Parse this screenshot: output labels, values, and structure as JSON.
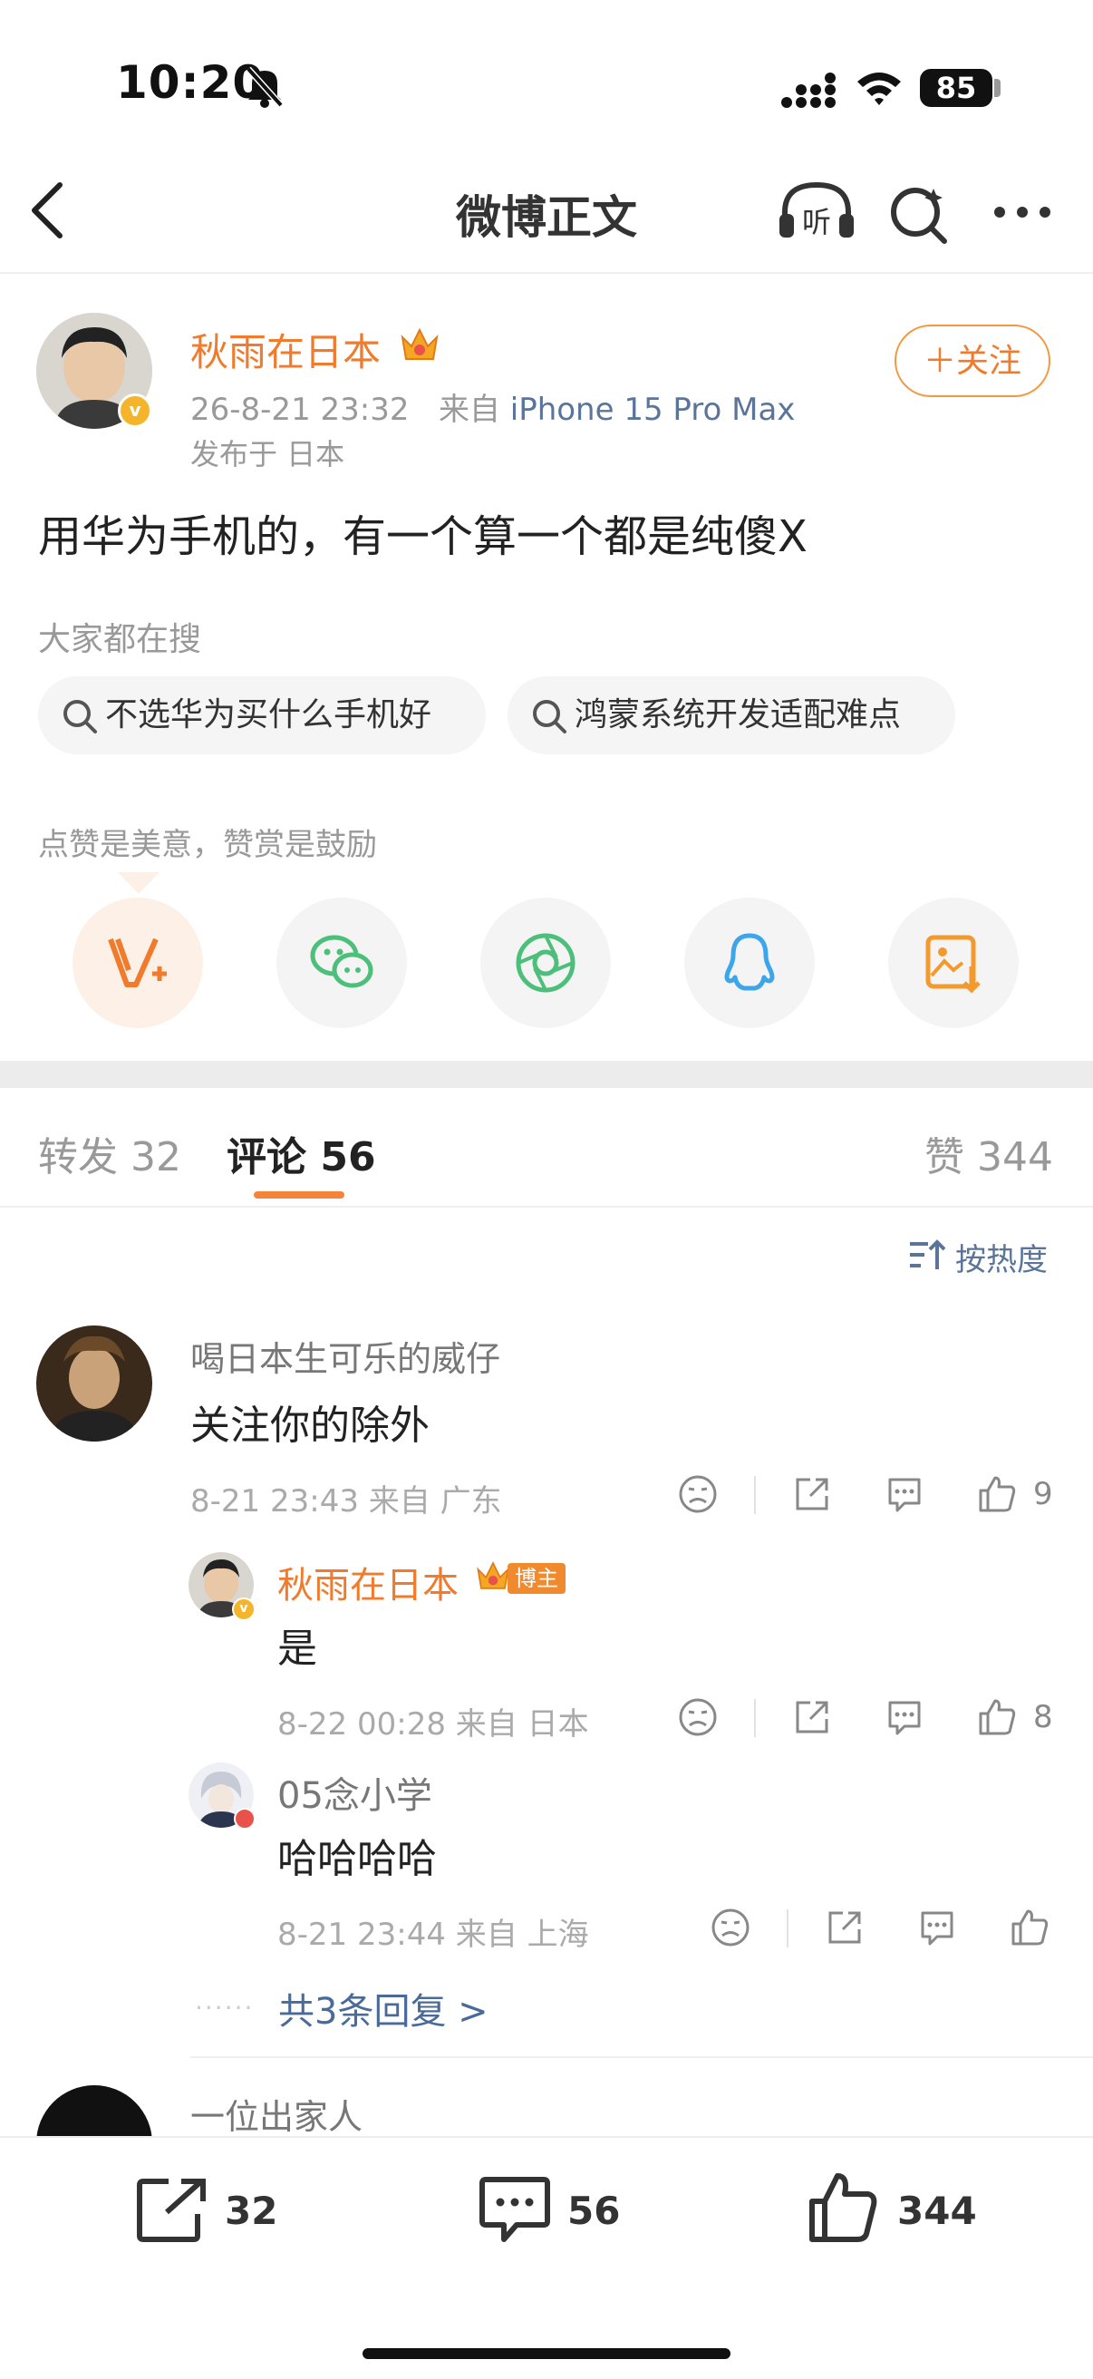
{
  "status_bar": {
    "time": "10:20",
    "battery": "85"
  },
  "nav": {
    "title": "微博正文"
  },
  "post": {
    "author": "秋雨在日本",
    "date": "26-8-21 23:32",
    "source_prefix": "来自",
    "device": "iPhone 15 Pro Max",
    "location": "发布于 日本",
    "follow_label": "＋关注",
    "text": "用华为手机的，有一个算一个都是纯傻X"
  },
  "search": {
    "label": "大家都在搜",
    "chips": [
      "不选华为买什么手机好",
      "鸿蒙系统开发适配难点"
    ]
  },
  "reward": {
    "label": "点赞是美意，赞赏是鼓励"
  },
  "tabs": {
    "repost": "转发 32",
    "comment_label": "评论",
    "comment_count": "56",
    "like": "赞 344"
  },
  "sort_label": "按热度",
  "comments": [
    {
      "user": "喝日本生可乐的威仔",
      "text": "关注你的除外",
      "meta": "8-21 23:43  来自 广东",
      "likes": "9",
      "replies": [
        {
          "user": "秋雨在日本",
          "badge": "博主",
          "text": "是",
          "meta": "8-22 00:28  来自 日本",
          "likes": "8"
        },
        {
          "user": "05念小学",
          "text": "哈哈哈哈",
          "meta": "8-21 23:44  来自 上海",
          "likes": ""
        }
      ],
      "more_replies": "共3条回复 >"
    },
    {
      "user": "一位出家人"
    }
  ],
  "bottom_bar": {
    "repost": "32",
    "comment": "56",
    "like": "344"
  },
  "colors": {
    "accent": "#f07b2c",
    "link": "#5a7599",
    "badge": "#f5b52a"
  }
}
